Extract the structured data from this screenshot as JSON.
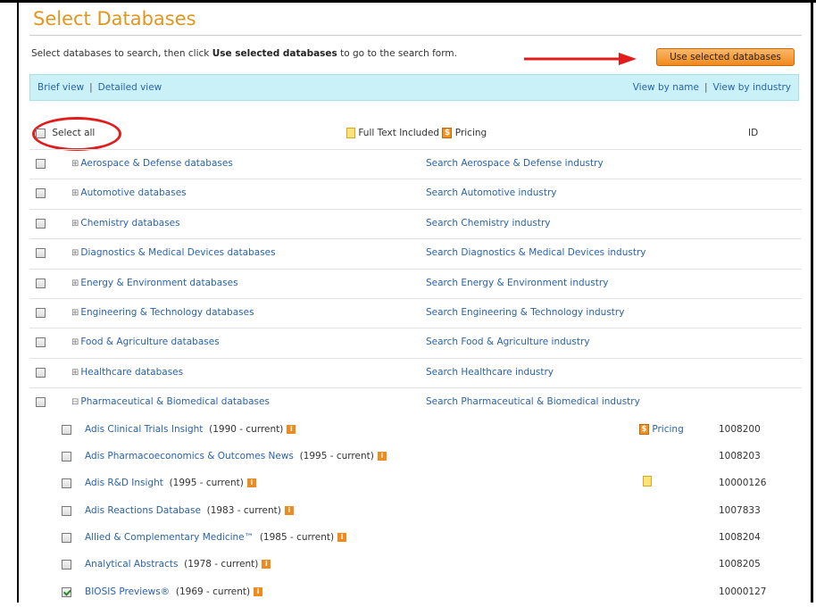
{
  "page": {
    "title": "Select Databases",
    "instruction_prefix": "Select databases to search, then click ",
    "instruction_bold": "Use selected databases",
    "instruction_suffix": " to go to the search form.",
    "use_button": "Use selected databases"
  },
  "viewbar": {
    "brief": "Brief view",
    "detailed": "Detailed view",
    "by_name": "View by name",
    "by_industry": "View by industry",
    "separator": "|"
  },
  "header": {
    "select_all": "Select all",
    "full_text": "Full Text Included",
    "pricing": "Pricing",
    "id": "ID"
  },
  "categories": [
    {
      "name": "Aerospace & Defense databases",
      "search": "Search Aerospace & Defense industry",
      "expander": "⊞"
    },
    {
      "name": "Automotive databases",
      "search": "Search Automotive industry",
      "expander": "⊞"
    },
    {
      "name": "Chemistry databases",
      "search": "Search Chemistry industry",
      "expander": "⊞"
    },
    {
      "name": "Diagnostics & Medical Devices databases",
      "search": "Search Diagnostics & Medical Devices industry",
      "expander": "⊞"
    },
    {
      "name": "Energy & Environment databases",
      "search": "Search Energy & Environment industry",
      "expander": "⊞"
    },
    {
      "name": "Engineering & Technology databases",
      "search": "Search Engineering & Technology industry",
      "expander": "⊞"
    },
    {
      "name": "Food & Agriculture databases",
      "search": "Search Food & Agriculture industry",
      "expander": "⊞"
    },
    {
      "name": "Healthcare databases",
      "search": "Search Healthcare industry",
      "expander": "⊞"
    },
    {
      "name": "Pharmaceutical & Biomedical databases",
      "search": "Search Pharmaceutical & Biomedical industry",
      "expander": "⊟"
    }
  ],
  "databases": [
    {
      "name": "Adis Clinical Trials Insight",
      "years": "(1990 - current)",
      "pricing": "Pricing",
      "id": "1008200"
    },
    {
      "name": "Adis Pharmacoeconomics & Outcomes News",
      "years": "(1995 - current)",
      "id": "1008203"
    },
    {
      "name": "Adis R&D Insight",
      "years": "(1995 - current)",
      "id": "10000126"
    },
    {
      "name": "Adis Reactions Database",
      "years": "(1983 - current)",
      "id": "1007833"
    },
    {
      "name": "Allied & Complementary Medicine™",
      "years": "(1985 - current)",
      "id": "1008204"
    },
    {
      "name": "Analytical Abstracts",
      "years": "(1978 - current)",
      "id": "1008205"
    },
    {
      "name": "BIOSIS Previews®",
      "years": "(1969 - current)",
      "id": "10000127"
    }
  ],
  "colors": {
    "title": "#e0961f",
    "link": "#2a63a8",
    "viewbar_bg": "#c9f1f7",
    "button": "#f08a1c",
    "highlight": "#e21b1b"
  }
}
